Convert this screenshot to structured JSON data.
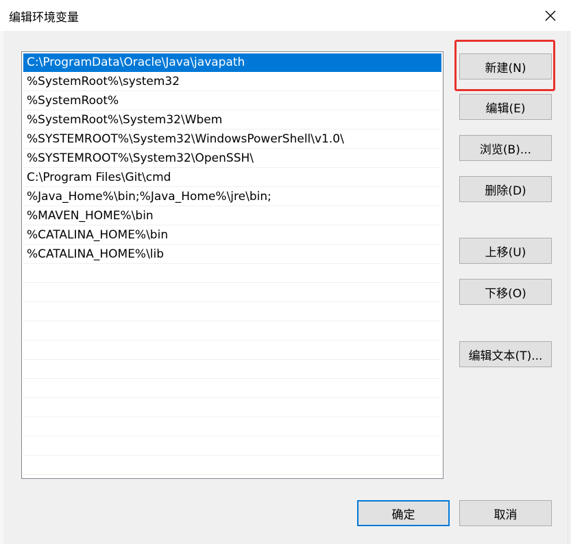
{
  "window": {
    "title": "编辑环境变量"
  },
  "list": {
    "items": [
      "C:\\ProgramData\\Oracle\\Java\\javapath",
      "%SystemRoot%\\system32",
      "%SystemRoot%",
      "%SystemRoot%\\System32\\Wbem",
      "%SYSTEMROOT%\\System32\\WindowsPowerShell\\v1.0\\",
      "%SYSTEMROOT%\\System32\\OpenSSH\\",
      "C:\\Program Files\\Git\\cmd",
      "%Java_Home%\\bin;%Java_Home%\\jre\\bin;",
      "%MAVEN_HOME%\\bin",
      "%CATALINA_HOME%\\bin",
      "%CATALINA_HOME%\\lib"
    ],
    "selected_index": 0
  },
  "buttons": {
    "new": "新建(N)",
    "edit": "编辑(E)",
    "browse": "浏览(B)...",
    "delete": "删除(D)",
    "move_up": "上移(U)",
    "move_down": "下移(O)",
    "edit_text": "编辑文本(T)...",
    "ok": "确定",
    "cancel": "取消"
  },
  "colors": {
    "selection": "#0078d7",
    "highlight_box": "#e8322c"
  }
}
